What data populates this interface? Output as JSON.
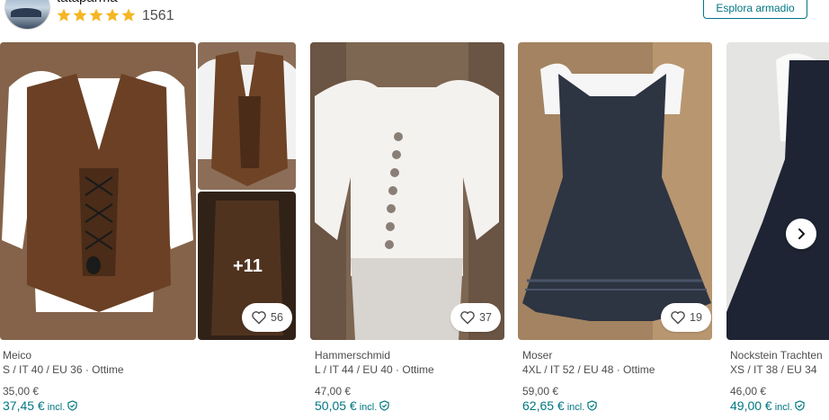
{
  "seller": {
    "name": "tataparma",
    "rating_stars": 5,
    "review_count": "1561",
    "explore_button": "Esplora armadio"
  },
  "items": [
    {
      "brand": "Meico",
      "details": "S / IT 40 / EU 36 · Ottime",
      "price": "35,00 €",
      "price_incl": "37,45 €",
      "incl_label": "incl.",
      "likes": "56",
      "extra_photos": "+11"
    },
    {
      "brand": "Hammerschmid",
      "details": "L / IT 44 / EU 40 · Ottime",
      "price": "47,00 €",
      "price_incl": "50,05 €",
      "incl_label": "incl.",
      "likes": "37"
    },
    {
      "brand": "Moser",
      "details": "4XL / IT 52 / EU 48 · Ottime",
      "price": "59,00 €",
      "price_incl": "62,65 €",
      "incl_label": "incl.",
      "likes": "19"
    },
    {
      "brand": "Nockstein Trachten",
      "details": "XS / IT 38 / EU 34",
      "price": "46,00 €",
      "price_incl": "49,00 €",
      "incl_label": "incl."
    }
  ],
  "colors": {
    "accent": "#007782",
    "star": "#f5b623",
    "text_secondary": "#4d4d4d"
  },
  "icons": {
    "heart": "heart-icon",
    "shield": "buyer-protection-icon",
    "next": "chevron-right-icon"
  }
}
